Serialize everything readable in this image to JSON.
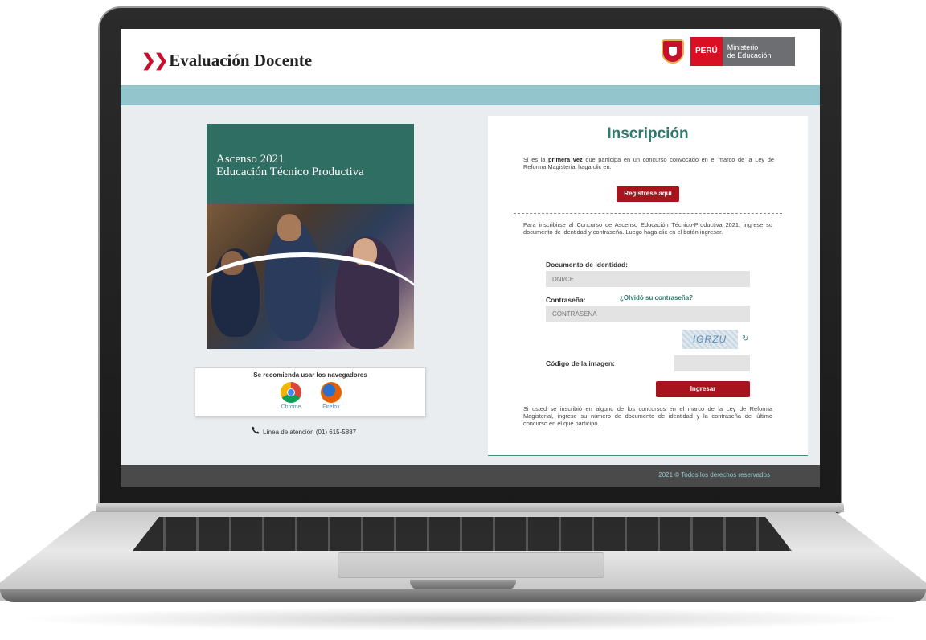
{
  "header": {
    "brand_chevron": "❯❯",
    "brand": "Evaluación Docente",
    "gov_peru": "PERÚ",
    "gov_ministry_line1": "Ministerio",
    "gov_ministry_line2": "de Educación"
  },
  "poster": {
    "title_line1": "Ascenso 2021",
    "title_line2": "Educación Técnico Productiva"
  },
  "browsers": {
    "title": "Se recomienda usar los navegadores",
    "items": [
      {
        "label": "Chrome",
        "icon": "chrome-icon"
      },
      {
        "label": "Firefox",
        "icon": "firefox-icon"
      }
    ]
  },
  "helpline": {
    "icon": "phone-icon",
    "text": "Línea de atención (01) 615-5887"
  },
  "form": {
    "title": "Inscripción",
    "intro_pre": "Si es la ",
    "intro_bold": "primera vez",
    "intro_post": " que participa en un concurso convocado en el marco de la Ley de Reforma Magisterial haga clic en:",
    "register_button": "Regístrese aquí",
    "instructions": "Para inscribirse al Concurso de Ascenso Educación Técnico-Productiva 2021, ingrese su documento de identidad y contraseña. Luego haga clic en el botón ingresar.",
    "doc_label": "Documento de identidad:",
    "doc_placeholder": "DNI/CE",
    "password_label": "Contraseña:",
    "forgot_link": "¿Olvidó su contraseña?",
    "password_placeholder": "CONTRASENA",
    "captcha_text": "IGRZU",
    "refresh_icon": "refresh-icon",
    "captcha_label": "Código de la imagen:",
    "submit_button": "Ingresar",
    "note": "Si usted se inscribió en alguno de los concursos en el marco de la Ley de Reforma Magisterial, ingrese su número de documento de identidad y la contraseña del último concurso en el que participó."
  },
  "footer": {
    "copyright": "2021 © Todos los derechos reservados"
  },
  "colors": {
    "accent_teal": "#2f7a6e",
    "band": "#93c5cc",
    "button_red": "#a8141d"
  }
}
